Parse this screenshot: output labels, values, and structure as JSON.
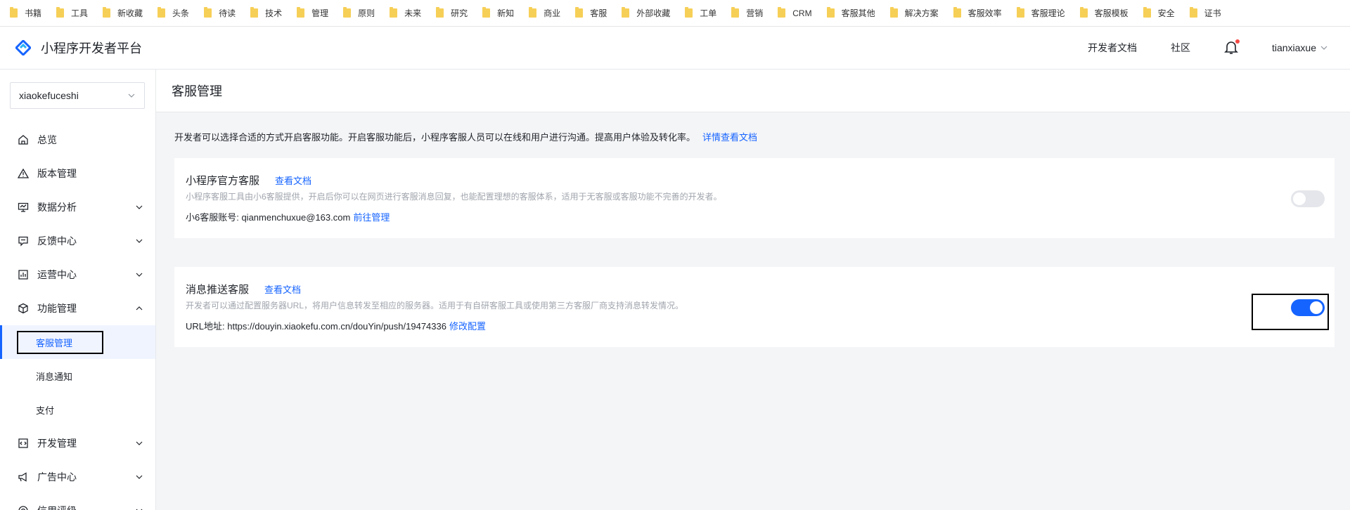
{
  "bookmarks": [
    "书籍",
    "工具",
    "新收藏",
    "头条",
    "待读",
    "技术",
    "管理",
    "原则",
    "未来",
    "研究",
    "新知",
    "商业",
    "客服",
    "外部收藏",
    "工单",
    "营销",
    "CRM",
    "客服其他",
    "解决方案",
    "客服效率",
    "客服理论",
    "客服模板",
    "安全",
    "证书"
  ],
  "header": {
    "brand": "小程序开发者平台",
    "docs_link": "开发者文档",
    "community_link": "社区",
    "username": "tianxiaxue"
  },
  "sidebar": {
    "app_select": "xiaokefuceshi",
    "items": [
      {
        "label": "总览",
        "icon": "home-icon"
      },
      {
        "label": "版本管理",
        "icon": "warning-icon"
      },
      {
        "label": "数据分析",
        "icon": "monitor-icon"
      },
      {
        "label": "反馈中心",
        "icon": "feedback-icon"
      },
      {
        "label": "运营中心",
        "icon": "chart-icon"
      },
      {
        "label": "功能管理",
        "icon": "cube-icon"
      },
      {
        "label": "开发管理",
        "icon": "code-icon"
      },
      {
        "label": "广告中心",
        "icon": "megaphone-icon"
      },
      {
        "label": "信用评级",
        "icon": "target-icon"
      }
    ],
    "sub_items": [
      "客服管理",
      "消息通知",
      "支付"
    ]
  },
  "main": {
    "page_title": "客服管理",
    "intro_text": "开发者可以选择合适的方式开启客服功能。开启客服功能后，小程序客服人员可以在线和用户进行沟通。提高用户体验及转化率。",
    "intro_link": "详情查看文档",
    "cards": [
      {
        "title": "小程序官方客服",
        "doc_link": "查看文档",
        "desc": "小程序客服工具由小6客服提供，开启后你可以在网页进行客服消息回复，也能配置理想的客服体系，适用于无客服或客服功能不完善的开发者。",
        "info_label": "小6客服账号: qianmenchuxue@163.com",
        "info_link": "前往管理",
        "enabled": false
      },
      {
        "title": "消息推送客服",
        "doc_link": "查看文档",
        "desc": "开发者可以通过配置服务器URL，将用户信息转发至相应的服务器。适用于有自研客服工具或使用第三方客服厂商支持消息转发情况。",
        "info_label": "URL地址: https://douyin.xiaokefu.com.cn/douYin/push/19474336",
        "info_link": "修改配置",
        "enabled": true
      }
    ]
  },
  "colors": {
    "accent": "#1664ff",
    "toggle_off": "#e5e6eb",
    "notify_dot": "#f54a45"
  }
}
